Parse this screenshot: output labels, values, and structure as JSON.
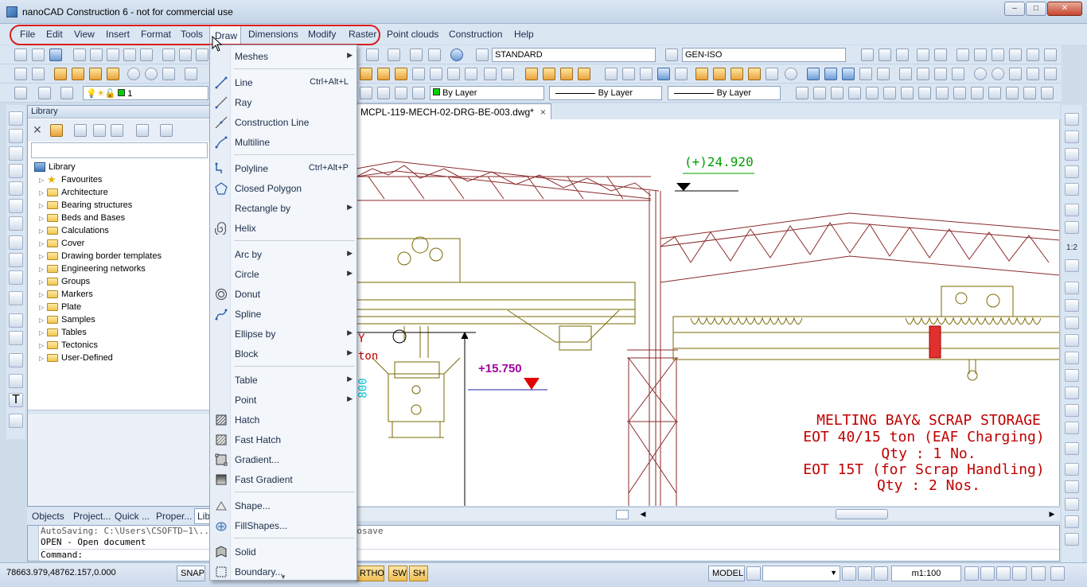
{
  "window": {
    "title": "nanoCAD Construction 6 - not for commercial use",
    "buttons": {
      "minimize": "–",
      "maximize": "□",
      "close": "✕"
    }
  },
  "menu": {
    "items": [
      "File",
      "Edit",
      "View",
      "Insert",
      "Format",
      "Tools",
      "Draw",
      "Dimensions",
      "Modify",
      "Raster",
      "Point clouds",
      "Construction",
      "Help"
    ],
    "active": "Draw"
  },
  "toolbar": {
    "text_style": "STANDARD",
    "dim_style": "GEN-ISO",
    "layer": "1",
    "color": "By Layer",
    "linetype": "By Layer",
    "lineweight": "By Layer"
  },
  "library": {
    "title": "Library",
    "root": "Library",
    "items": [
      "Favourites",
      "Architecture",
      "Bearing structures",
      "Beds and Bases",
      "Calculations",
      "Cover",
      "Drawing border templates",
      "Engineering networks",
      "Groups",
      "Markers",
      "Plate",
      "Samples",
      "Tables",
      "Tectonics",
      "User-Defined"
    ]
  },
  "panel_tabs": [
    "Objects",
    "Project...",
    "Quick ...",
    "Proper...",
    "Libr"
  ],
  "document": {
    "tab": "MCPL-119-MECH-02-DRG-BE-003.dwg*",
    "close": "×"
  },
  "drawing": {
    "level_top": "(+)24.920",
    "level_mid": "+15.750",
    "side_y": "Y",
    "side_ton": "ton",
    "side_800": "800",
    "notes": [
      "MELTING BAY& SCRAP STORAGE",
      "EOT 40/15  ton (EAF Charging)",
      "Qty : 1 No.",
      "EOT 15T (for Scrap Handling)",
      "Qty : 2 Nos."
    ],
    "colors": {
      "structure": "#8b2a2a",
      "crane": "#7a6a00",
      "text_red": "#c00000",
      "level_green": "#00a000",
      "level_purple": "#a000a0",
      "dim_cyan": "#00c8e0"
    }
  },
  "draw_menu": {
    "items": [
      {
        "label": "Meshes",
        "shortcut": "",
        "submenu": true,
        "icon": ""
      },
      {
        "label": "Line",
        "shortcut": "Ctrl+Alt+L",
        "submenu": false,
        "icon": "line-icon"
      },
      {
        "label": "Ray",
        "shortcut": "",
        "submenu": false,
        "icon": "ray-icon"
      },
      {
        "label": "Construction Line",
        "shortcut": "",
        "submenu": false,
        "icon": "construction-line-icon"
      },
      {
        "label": "Multiline",
        "shortcut": "",
        "submenu": false,
        "icon": "multiline-icon"
      },
      {
        "label": "Polyline",
        "shortcut": "Ctrl+Alt+P",
        "submenu": false,
        "icon": "polyline-icon"
      },
      {
        "label": "Closed Polygon",
        "shortcut": "",
        "submenu": false,
        "icon": "polygon-icon"
      },
      {
        "label": "Rectangle by",
        "shortcut": "",
        "submenu": true,
        "icon": ""
      },
      {
        "label": "Helix",
        "shortcut": "",
        "submenu": false,
        "icon": "helix-icon"
      },
      {
        "label": "Arc by",
        "shortcut": "",
        "submenu": true,
        "icon": ""
      },
      {
        "label": "Circle",
        "shortcut": "",
        "submenu": true,
        "icon": ""
      },
      {
        "label": "Donut",
        "shortcut": "",
        "submenu": false,
        "icon": "donut-icon"
      },
      {
        "label": "Spline",
        "shortcut": "",
        "submenu": false,
        "icon": "spline-icon"
      },
      {
        "label": "Ellipse by",
        "shortcut": "",
        "submenu": true,
        "icon": ""
      },
      {
        "label": "Block",
        "shortcut": "",
        "submenu": true,
        "icon": ""
      },
      {
        "label": "Table",
        "shortcut": "",
        "submenu": true,
        "icon": ""
      },
      {
        "label": "Point",
        "shortcut": "",
        "submenu": true,
        "icon": ""
      },
      {
        "label": "Hatch",
        "shortcut": "",
        "submenu": false,
        "icon": "hatch-icon"
      },
      {
        "label": "Fast Hatch",
        "shortcut": "",
        "submenu": false,
        "icon": "fast-hatch-icon"
      },
      {
        "label": "Gradient...",
        "shortcut": "",
        "submenu": false,
        "icon": "gradient-icon"
      },
      {
        "label": "Fast Gradient",
        "shortcut": "",
        "submenu": false,
        "icon": "fast-gradient-icon"
      },
      {
        "label": "Shape...",
        "shortcut": "",
        "submenu": false,
        "icon": "shape-icon"
      },
      {
        "label": "FillShapes...",
        "shortcut": "",
        "submenu": false,
        "icon": "fillshapes-icon"
      },
      {
        "label": "Solid",
        "shortcut": "",
        "submenu": false,
        "icon": "solid-icon"
      },
      {
        "label": "Boundary...",
        "shortcut": "",
        "submenu": false,
        "icon": "boundary-icon"
      }
    ]
  },
  "command": {
    "lines": [
      "AutoSaving: C:\\Users\\CSOFTD~1\\...\\(9-43-14 Ff_8-23-2016).autosave",
      "OPEN - Open document",
      "Command:"
    ]
  },
  "status": {
    "coords": "78663.979,48762.157,0.000",
    "snap": "SNAP",
    "ortho": "RTHO",
    "sw": "SW",
    "sh": "SH",
    "model": "MODEL",
    "scale": "m1:100"
  }
}
